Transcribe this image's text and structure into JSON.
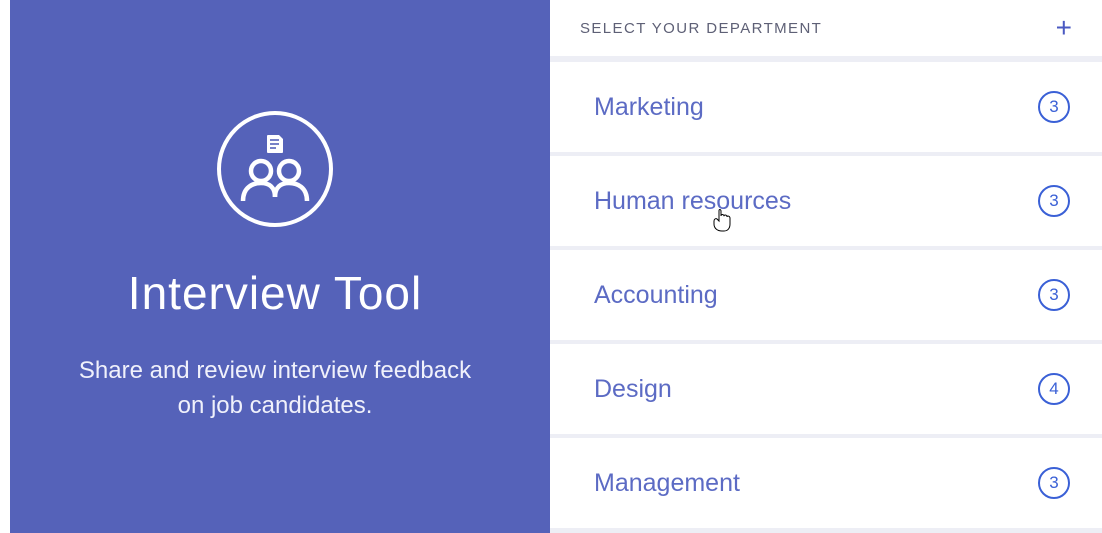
{
  "colors": {
    "brand": "#5562b9",
    "accent": "#3a60d6",
    "text_muted": "#5c6bc4"
  },
  "left": {
    "title": "Interview Tool",
    "subtitle": "Share and review interview feedback on job candidates.",
    "icon": "interview-people-icon"
  },
  "header": {
    "label": "SELECT YOUR DEPARTMENT",
    "add_icon": "plus-icon"
  },
  "departments": [
    {
      "name": "Marketing",
      "count": "3"
    },
    {
      "name": "Human resources",
      "count": "3"
    },
    {
      "name": "Accounting",
      "count": "3"
    },
    {
      "name": "Design",
      "count": "4"
    },
    {
      "name": "Management",
      "count": "3"
    }
  ]
}
